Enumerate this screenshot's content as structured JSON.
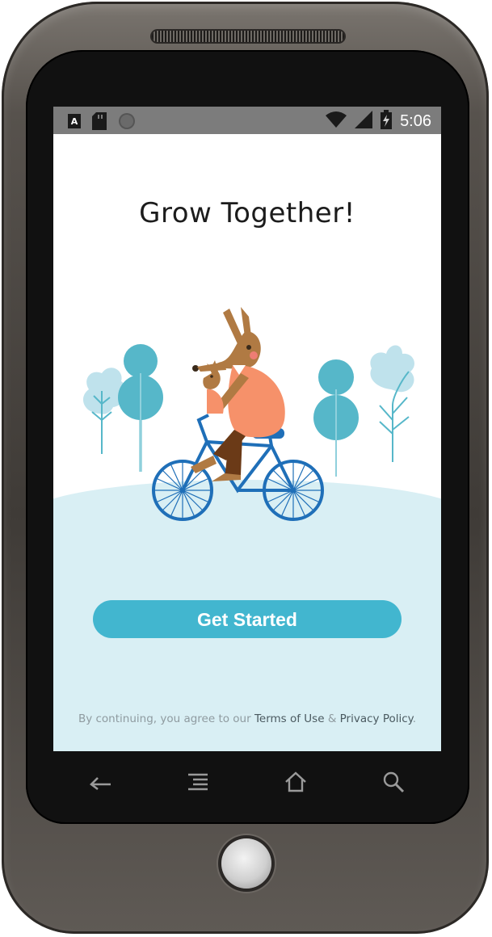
{
  "status_bar": {
    "icons_left": [
      "keyboard-a-icon",
      "sd-card-icon",
      "sync-circle-icon"
    ],
    "icons_right": [
      "wifi-icon",
      "signal-icon",
      "battery-charging-icon"
    ],
    "time": "5:06"
  },
  "onboarding": {
    "title": "Grow Together!",
    "get_started_label": "Get Started",
    "legal_prefix": "By continuing, you agree to our ",
    "terms_label": "Terms of Use",
    "legal_and": " & ",
    "privacy_label": "Privacy Policy",
    "legal_suffix": "."
  },
  "illustration": {
    "subject": "kangaroo-with-joey-riding-bicycle",
    "colors": {
      "ground": "#d9eff4",
      "tree_dark": "#56b7c9",
      "tree_light": "#bfe2ec",
      "bike": "#1f6fb8",
      "kangaroo": "#b07a43",
      "shirt": "#f6916a"
    }
  },
  "nav_bar": {
    "icons": [
      "back-icon",
      "menu-icon",
      "home-icon",
      "search-icon"
    ]
  },
  "colors": {
    "accent": "#42b6cf",
    "status_bar": "#7c7c7c",
    "title_text": "#1c1c1c"
  }
}
